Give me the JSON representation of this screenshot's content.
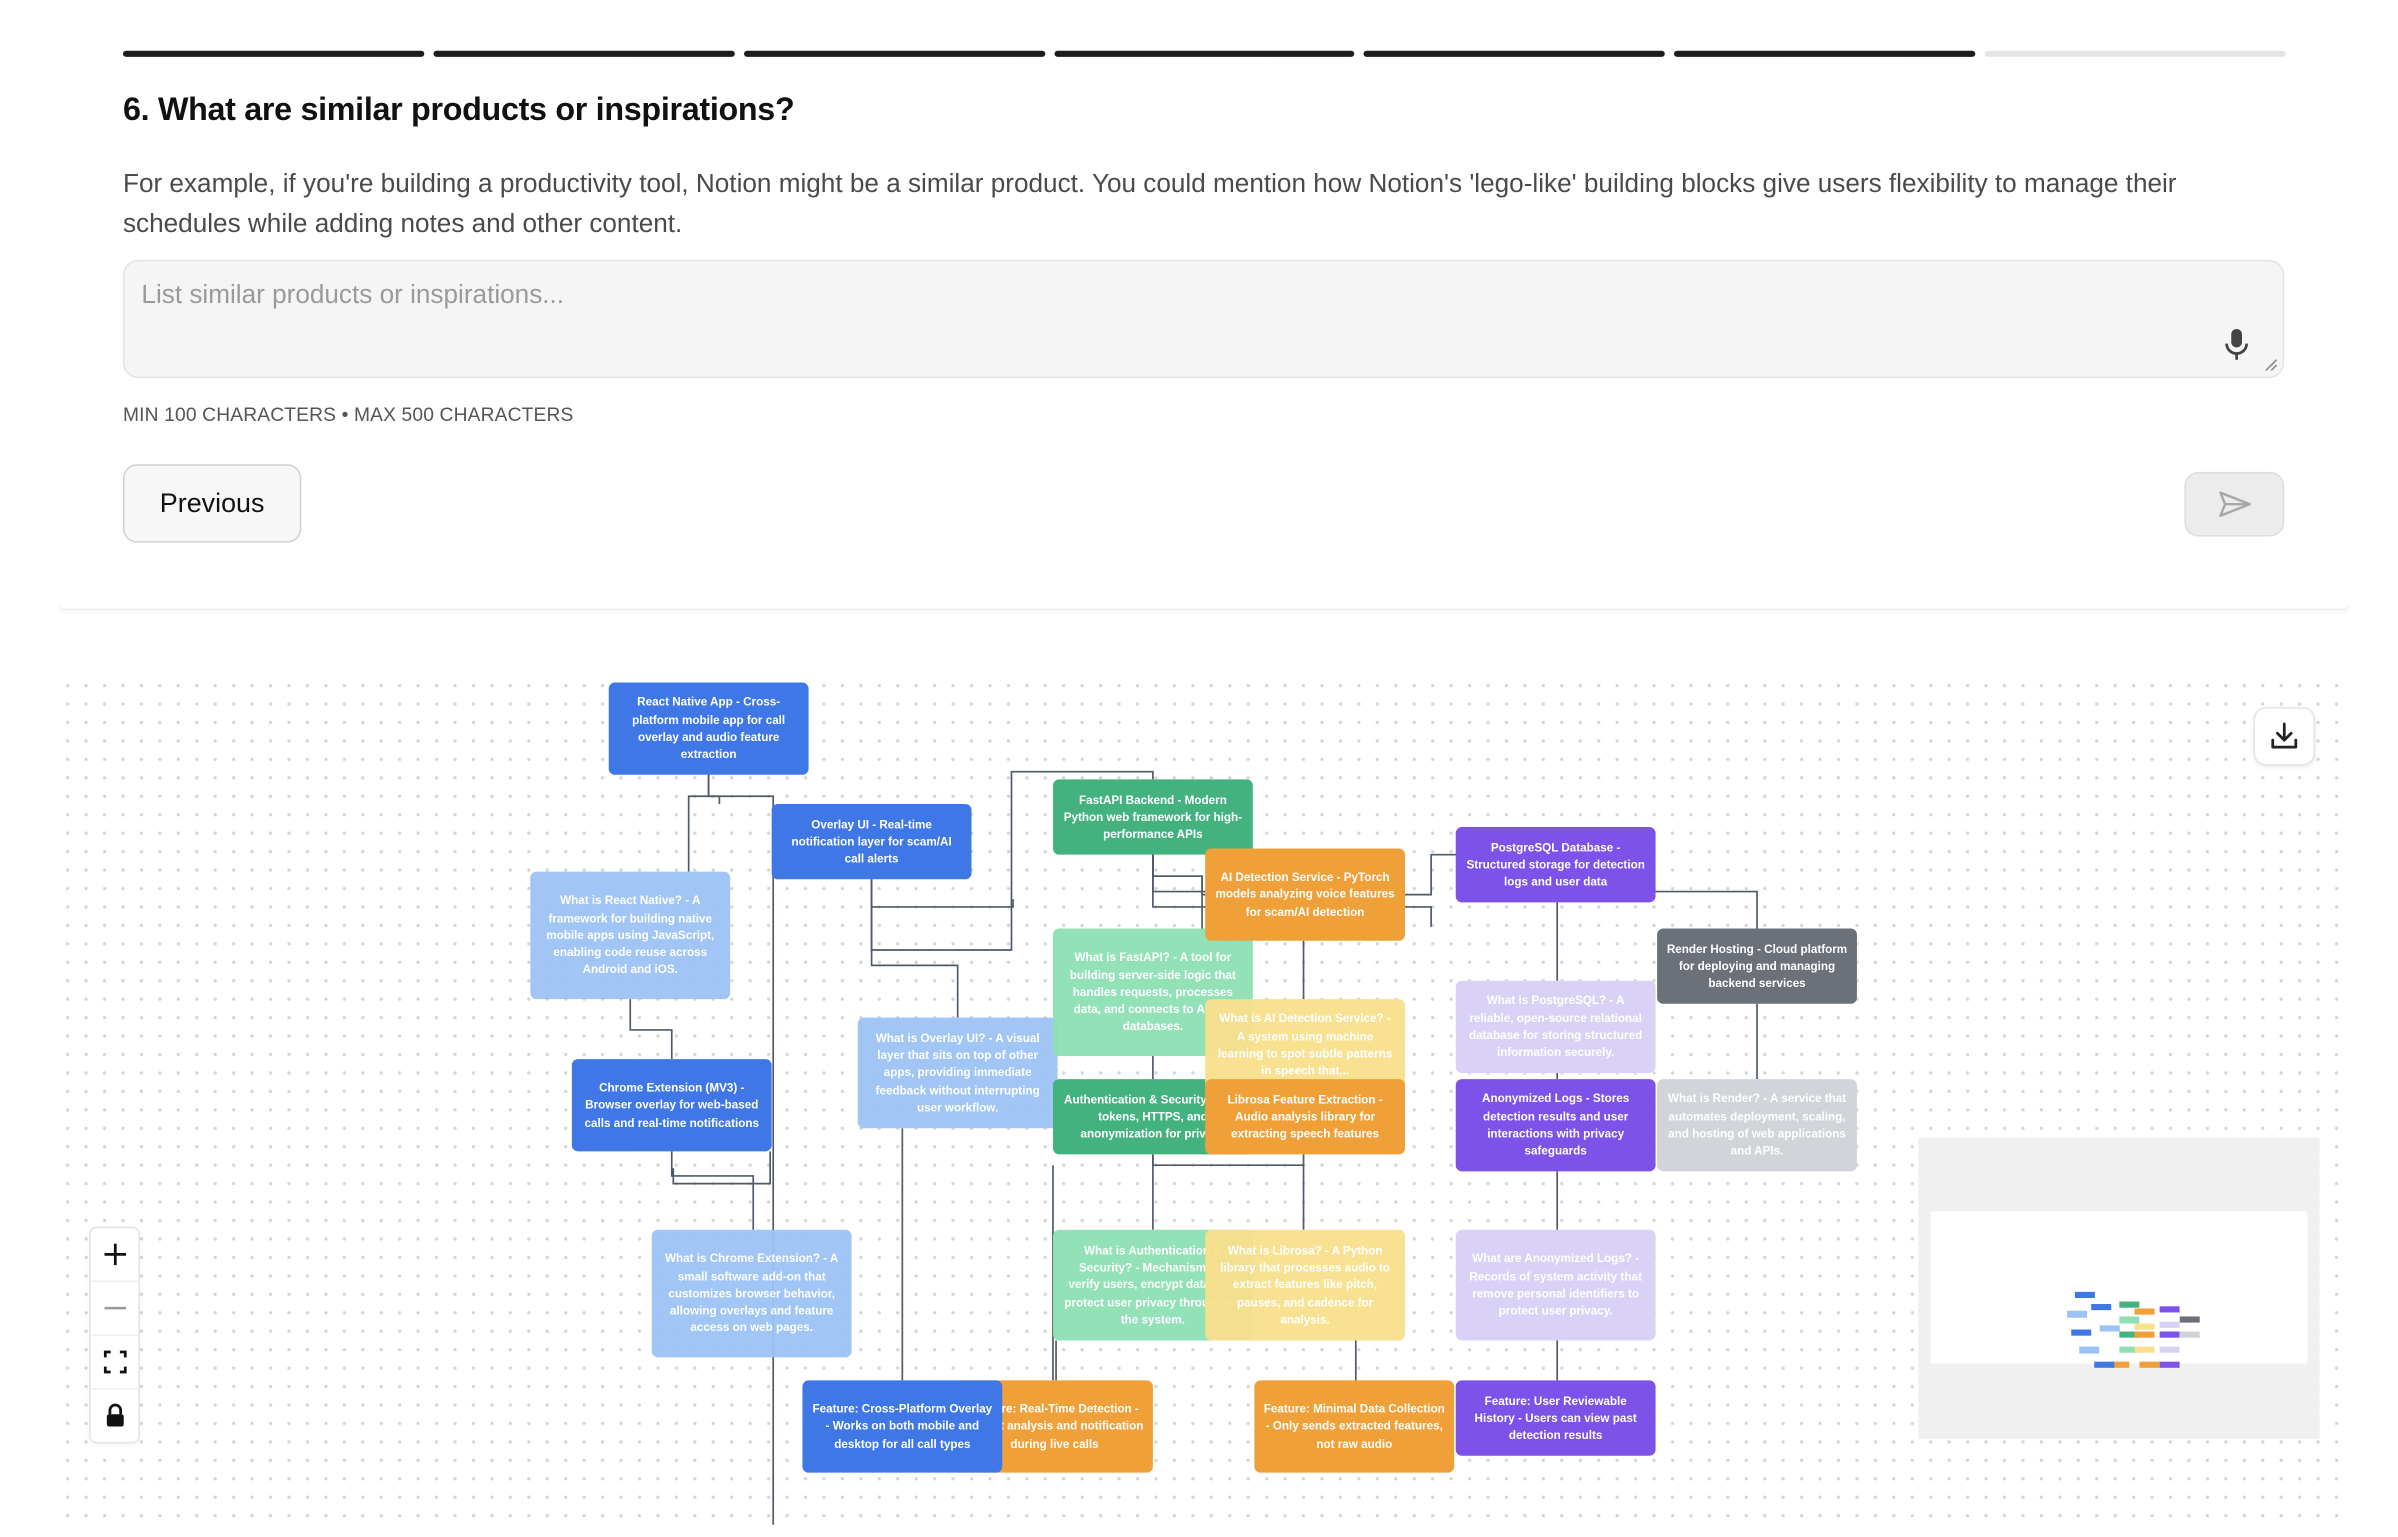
{
  "progress": {
    "total_steps": 7,
    "completed_steps": 6
  },
  "question": {
    "title": "6. What are similar products or inspirations?",
    "description": "For example, if you're building a productivity tool, Notion might be a similar product. You could mention how Notion's 'lego-like' building blocks give users flexibility to manage their schedules while adding notes and other content."
  },
  "answer": {
    "value": "",
    "placeholder": "List similar products or inspirations..."
  },
  "limits_text": "MIN 100 CHARACTERS • MAX 500 CHARACTERS",
  "buttons": {
    "previous": "Previous"
  },
  "colors": {
    "blue": "#3f78e6",
    "light_blue": "#9cc3f5",
    "green": "#44b27e",
    "light_green": "#8ee0b3",
    "orange": "#efa039",
    "light_yellow": "#f8e08c",
    "purple": "#7c52e8",
    "light_purple": "#d9d0f6",
    "gray": "#6b7079",
    "light_gray": "#cfd2d6"
  },
  "mindmap": {
    "nodes": [
      {
        "id": "react-native-app",
        "text": "React Native App - Cross-platform mobile app for call overlay and audio feature extraction",
        "color": "blue"
      },
      {
        "id": "overlay-ui",
        "text": "Overlay UI - Real-time notification layer for scam/AI call alerts",
        "color": "blue"
      },
      {
        "id": "what-react-native",
        "text": "What is React Native? - A framework for building native mobile apps using JavaScript, enabling code reuse across Android and iOS.",
        "color": "light_blue"
      },
      {
        "id": "chrome-extension",
        "text": "Chrome Extension (MV3) - Browser overlay for web-based calls and real-time notifications",
        "color": "blue"
      },
      {
        "id": "what-overlay",
        "text": "What is Overlay UI? - A visual layer that sits on top of other apps, providing immediate feedback without interrupting user workflow.",
        "color": "light_blue"
      },
      {
        "id": "what-chrome-ext",
        "text": "What is Chrome Extension? - A small software add-on that customizes browser behavior, allowing overlays and feature access on web pages.",
        "color": "light_blue"
      },
      {
        "id": "fastapi-backend",
        "text": "FastAPI Backend - Modern Python web framework for high-performance APIs",
        "color": "green"
      },
      {
        "id": "what-fastapi",
        "text": "What is FastAPI? - A tool for building server-side logic that handles requests, processes data, and connects to AI and databases.",
        "color": "light_green"
      },
      {
        "id": "auth-security",
        "text": "Authentication & Security - JWT tokens, HTTPS, and anonymization for privacy",
        "color": "green"
      },
      {
        "id": "what-auth",
        "text": "What is Authentication & Security? - Mechanisms to verify users, encrypt data, and protect user privacy throughout the system.",
        "color": "light_green"
      },
      {
        "id": "ai-detection",
        "text": "AI Detection Service - PyTorch models analyzing voice features for scam/AI detection",
        "color": "orange"
      },
      {
        "id": "what-ai-detection",
        "text": "What is AI Detection Service? - A system using machine learning to spot subtle patterns in speech that...",
        "color": "light_yellow"
      },
      {
        "id": "librosa",
        "text": "Librosa Feature Extraction - Audio analysis library for extracting speech features",
        "color": "orange"
      },
      {
        "id": "what-librosa",
        "text": "What is Librosa? - A Python library that processes audio to extract features like pitch, pauses, and cadence for analysis.",
        "color": "light_yellow"
      },
      {
        "id": "postgres",
        "text": "PostgreSQL Database - Structured storage for detection logs and user data",
        "color": "purple"
      },
      {
        "id": "what-postgres",
        "text": "What is PostgreSQL? - A reliable, open-source relational database for storing structured information securely.",
        "color": "light_purple"
      },
      {
        "id": "anon-logs",
        "text": "Anonymized Logs - Stores detection results and user interactions with privacy safeguards",
        "color": "purple"
      },
      {
        "id": "what-anon-logs",
        "text": "What are Anonymized Logs? - Records of system activity that remove personal identifiers to protect user privacy.",
        "color": "light_purple"
      },
      {
        "id": "render-hosting",
        "text": "Render Hosting - Cloud platform for deploying and managing backend services",
        "color": "gray"
      },
      {
        "id": "what-render",
        "text": "What is Render? - A service that automates deployment, scaling, and hosting of web applications and APIs.",
        "color": "light_gray"
      },
      {
        "id": "feat-cross-platform",
        "text": "Feature: Cross-Platform Overlay - Works on both mobile and desktop for all call types",
        "color": "blue"
      },
      {
        "id": "feat-realtime",
        "text": "Feature: Real-Time Detection - Instant analysis and notification during live calls",
        "color": "orange"
      },
      {
        "id": "feat-minimal-data",
        "text": "Feature: Minimal Data Collection - Only sends extracted features, not raw audio",
        "color": "orange"
      },
      {
        "id": "feat-history",
        "text": "Feature: User Reviewable History - Users can view past detection results",
        "color": "purple"
      }
    ]
  }
}
